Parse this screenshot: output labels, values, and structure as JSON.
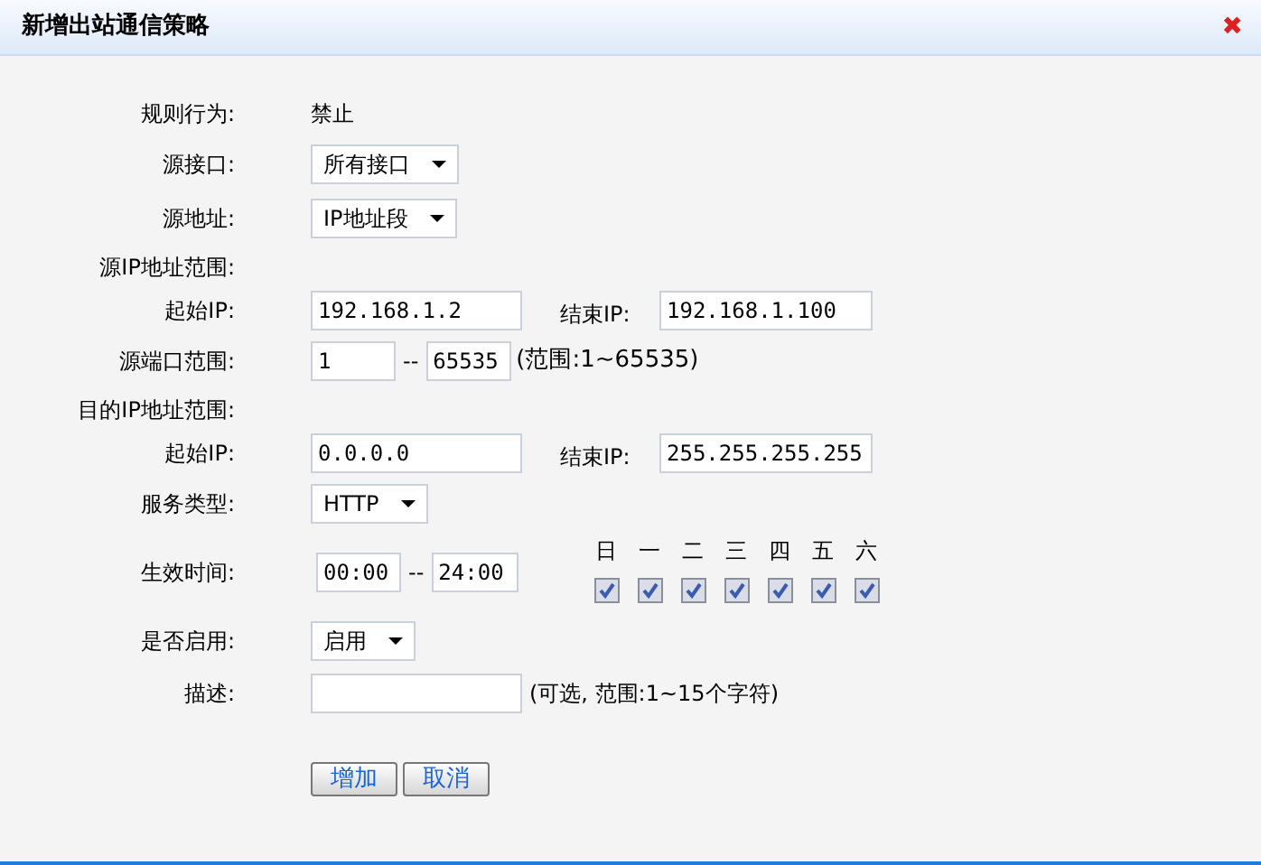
{
  "window": {
    "title": "新增出站通信策略",
    "close": "✖"
  },
  "rows": [
    {
      "kind": "text",
      "label": "规则行为:",
      "value": "禁止"
    },
    {
      "kind": "select",
      "label": "源接口:",
      "value": "所有接口"
    },
    {
      "kind": "select",
      "label": "源地址:",
      "value": "IP地址段"
    },
    {
      "kind": "heading",
      "label": "源IP地址范围:"
    },
    {
      "kind": "iprange",
      "label": "起始IP:",
      "start": "192.168.1.2",
      "end_label": "结束IP:",
      "end": "192.168.1.100"
    },
    {
      "kind": "portrange",
      "label": "源端口范围:",
      "start": "1",
      "sep": "--",
      "end": "65535",
      "hint": "(范围:1~65535)"
    },
    {
      "kind": "heading",
      "label": "目的IP地址范围:"
    },
    {
      "kind": "iprange",
      "label": "起始IP:",
      "start": "0.0.0.0",
      "end_label": "结束IP:",
      "end": "255.255.255.255"
    },
    {
      "kind": "select",
      "label": "服务类型:",
      "value": "HTTP"
    },
    {
      "kind": "timerange",
      "label": "生效时间:",
      "start": "00:00",
      "sep": "--",
      "end": "24:00",
      "days": [
        {
          "label": "日",
          "checked": true
        },
        {
          "label": "一",
          "checked": true
        },
        {
          "label": "二",
          "checked": true
        },
        {
          "label": "三",
          "checked": true
        },
        {
          "label": "四",
          "checked": true
        },
        {
          "label": "五",
          "checked": true
        },
        {
          "label": "六",
          "checked": true
        }
      ]
    },
    {
      "kind": "select",
      "label": "是否启用:",
      "value": "启用"
    },
    {
      "kind": "input",
      "label": "描述:",
      "hint": "(可选, 范围:1~15个字符)"
    }
  ],
  "buttons": [
    "增加",
    "取消"
  ]
}
